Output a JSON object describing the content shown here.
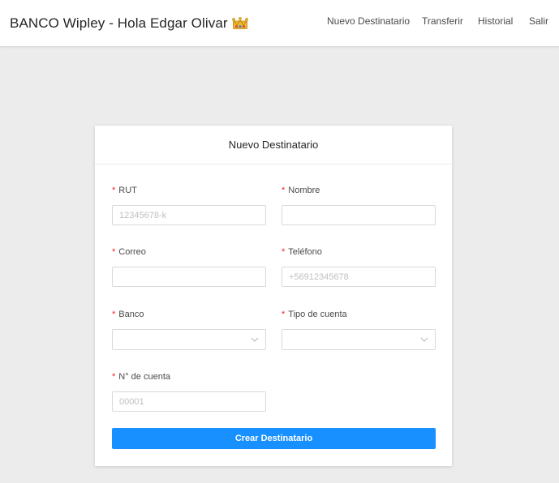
{
  "header": {
    "brand": "BANCO Wipley - Hola Edgar Olivar",
    "brand_icon": "crown-icon",
    "nav": [
      "Nuevo Destinatario",
      "Transferir",
      "Historial",
      "Salir"
    ]
  },
  "form": {
    "title": "Nuevo Destinatario",
    "required_mark": "*",
    "fields": {
      "rut": {
        "label": "RUT",
        "placeholder": "12345678-k",
        "value": ""
      },
      "nombre": {
        "label": "Nombre",
        "placeholder": "",
        "value": ""
      },
      "correo": {
        "label": "Correo",
        "placeholder": "",
        "value": ""
      },
      "telefono": {
        "label": "Teléfono",
        "placeholder": "+56912345678",
        "value": ""
      },
      "banco": {
        "label": "Banco",
        "value": ""
      },
      "tipo_cuenta": {
        "label": "Tipo de cuenta",
        "value": ""
      },
      "numero_cuenta": {
        "label": "N° de cuenta",
        "placeholder": "00001",
        "value": ""
      }
    },
    "submit_label": "Crear Destinatario"
  },
  "colors": {
    "primary": "#1890ff",
    "required": "#f5222d",
    "background": "#ececec",
    "crown": "#f2b632"
  }
}
